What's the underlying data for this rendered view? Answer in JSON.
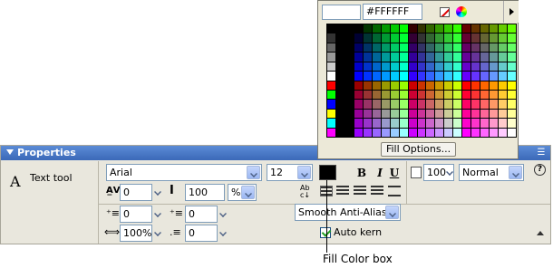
{
  "panel": {
    "title": "Properties",
    "tool_name": "Text tool"
  },
  "font": {
    "family": "Arial",
    "size": "12"
  },
  "style": {
    "bold": "B",
    "italic": "I",
    "underline": "U"
  },
  "row2": {
    "letter_spacing": "0",
    "line_spacing": "100",
    "units": "%"
  },
  "row3": {
    "indent": "0",
    "right_margin": "0",
    "anti_alias": "Smooth Anti-Alias"
  },
  "row4": {
    "width_pct": "100%",
    "left_margin": "0",
    "auto_kern": "Auto kern"
  },
  "alpha": {
    "value": "100",
    "blend": "Normal"
  },
  "help_icon": "?",
  "color_popup": {
    "hex": "#FFFFFF",
    "options_label": "Fill Options..."
  },
  "caption": "Fill Color box",
  "colors": {
    "header": "#3b69b8",
    "panel_bg": "#e9e7dd"
  },
  "icons": [
    "text-tool-icon",
    "letter-spacing-icon",
    "line-spacing-icon",
    "indent-icon",
    "right-margin-icon",
    "width-icon",
    "left-margin-icon",
    "no-color-icon",
    "color-wheel-icon",
    "expand-arrow-icon",
    "help-icon",
    "options-menu-icon",
    "collapse-icon"
  ]
}
